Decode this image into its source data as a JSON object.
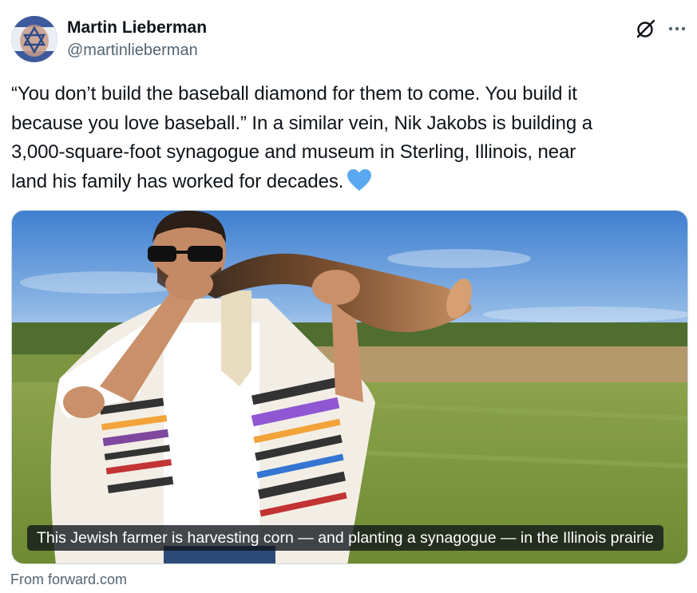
{
  "author": {
    "display_name": "Martin Lieberman",
    "handle": "@martinlieberman"
  },
  "tweet": {
    "text_line1": "“You don’t build the baseball diamond for them to come. You build it",
    "text_line2": "because you love baseball.” In a similar vein, Nik Jakobs is building a",
    "text_line3": "3,000-square-foot synagogue and museum in Sterling, Illinois, near",
    "text_line4": "land his family has worked for decades.",
    "emoji": "blue-heart"
  },
  "card": {
    "caption": "This Jewish farmer is harvesting corn — and planting a synagogue — in the Illinois prairie",
    "source": "From forward.com"
  },
  "icons": {
    "grok": "grok-icon",
    "more": "more-icon"
  },
  "colors": {
    "text_primary": "#0f1419",
    "text_secondary": "#536471",
    "heart": "#5aa9f0"
  }
}
